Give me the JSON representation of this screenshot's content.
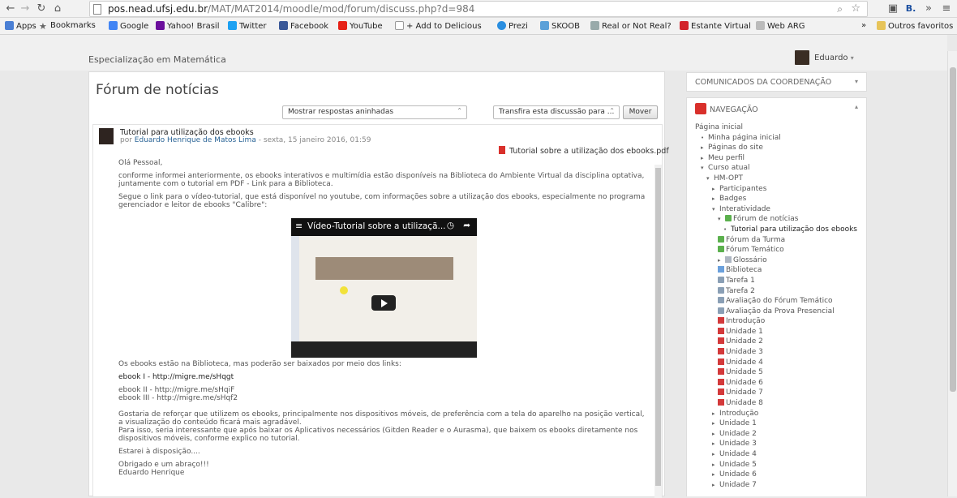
{
  "browser": {
    "url_host": "pos.nead.ufsj.edu.br",
    "url_path": "/MAT/MAT2014/moodle/mod/forum/discuss.php?d=984",
    "bookmarks": [
      "Apps",
      "Bookmarks",
      "Google",
      "Yahoo! Brasil",
      "Twitter",
      "Facebook",
      "YouTube",
      "+ Add to Delicious",
      "Prezi",
      "SKOOB",
      "Real or Not Real?",
      "Estante Virtual",
      "Web ARG"
    ],
    "overflow": "»",
    "other_bookmarks": "Outros favoritos"
  },
  "header": {
    "site_name": "Especialização em Matemática",
    "user_name": "Eduardo"
  },
  "forum": {
    "title": "Fórum de notícias",
    "display_mode": "Mostrar respostas aninhadas",
    "move_select": "Transfira esta discussão para ...",
    "move_button": "Mover"
  },
  "post": {
    "subject": "Tutorial para utilização dos ebooks",
    "by_prefix": "por",
    "author": "Eduardo Henrique de Matos Lima",
    "date": " - sexta, 15 janeiro 2016, 01:59",
    "attachment": "Tutorial sobre a utilização dos ebooks.pdf",
    "greeting": "Olá Pessoal,",
    "p1": "conforme informei anteriormente, os ebooks interativos e multimídia estão disponíveis na Biblioteca do Ambiente Virtual da disciplina optativa, juntamente com o tutorial em PDF - Link para a Biblioteca.",
    "p2": "Segue o link para o vídeo-tutorial, que está disponível no youtube, com informações sobre a utilização dos ebooks, especialmente no programa gerenciador e leitor de ebooks \"Calibre\":",
    "video_title": "Vídeo-Tutorial sobre a utilizaçã...",
    "p3": "Os ebooks estão na Biblioteca, mas poderão ser baixados por meio dos links:",
    "link1": "ebook I - http://migre.me/sHqgt",
    "link2": "ebook II - http://migre.me/sHqiF",
    "link3": "ebook III - http://migre.me/sHqf2",
    "p4": "Gostaria de reforçar que utilizem os ebooks, principalmente nos dispositivos móveis, de preferência com a tela do aparelho na posição vertical, a visualização do conteúdo ficará mais agradável.",
    "p5": "Para isso, seria interessante que após baixar os Aplicativos necessários (Gitden Reader e o Aurasma), que baixem os ebooks diretamente nos dispositivos móveis, conforme explico no tutorial.",
    "p6": "Estarei à disposição....",
    "p7": "Obrigado e um abraço!!!",
    "signature": "Eduardo Henrique"
  },
  "blocks": {
    "comunicados": "COMUNICADOS DA COORDENAÇÃO",
    "navegacao": "NAVEGAÇÃO"
  },
  "nav": [
    {
      "label": "Página inicial",
      "indent": 0,
      "marker": "",
      "icon": ""
    },
    {
      "label": "Minha página inicial",
      "indent": 1,
      "marker": "•",
      "icon": ""
    },
    {
      "label": "Páginas do site",
      "indent": 1,
      "marker": "▸",
      "icon": ""
    },
    {
      "label": "Meu perfil",
      "indent": 1,
      "marker": "▸",
      "icon": ""
    },
    {
      "label": "Curso atual",
      "indent": 1,
      "marker": "▾",
      "icon": ""
    },
    {
      "label": "HM-OPT",
      "indent": 2,
      "marker": "▾",
      "icon": ""
    },
    {
      "label": "Participantes",
      "indent": 3,
      "marker": "▸",
      "icon": ""
    },
    {
      "label": "Badges",
      "indent": 3,
      "marker": "▸",
      "icon": ""
    },
    {
      "label": "Interatividade",
      "indent": 3,
      "marker": "▾",
      "icon": ""
    },
    {
      "label": "Fórum de notícias",
      "indent": 4,
      "marker": "▾",
      "icon": "g"
    },
    {
      "label": "Tutorial para utilização dos ebooks",
      "indent": 5,
      "marker": "•",
      "icon": "",
      "bold": true
    },
    {
      "label": "Fórum da Turma",
      "indent": 4,
      "marker": "",
      "icon": "g"
    },
    {
      "label": "Fórum Temático",
      "indent": 4,
      "marker": "",
      "icon": "g"
    },
    {
      "label": "Glossário",
      "indent": 4,
      "marker": "▸",
      "icon": "y"
    },
    {
      "label": "Biblioteca",
      "indent": 4,
      "marker": "",
      "icon": "b"
    },
    {
      "label": "Tarefa 1",
      "indent": 4,
      "marker": "",
      "icon": "a"
    },
    {
      "label": "Tarefa 2",
      "indent": 4,
      "marker": "",
      "icon": "a"
    },
    {
      "label": "Avaliação do Fórum Temático",
      "indent": 4,
      "marker": "",
      "icon": "a"
    },
    {
      "label": "Avaliação da Prova Presencial",
      "indent": 4,
      "marker": "",
      "icon": "a"
    },
    {
      "label": "Introdução",
      "indent": 4,
      "marker": "",
      "icon": "r"
    },
    {
      "label": "Unidade 1",
      "indent": 4,
      "marker": "",
      "icon": "r"
    },
    {
      "label": "Unidade 2",
      "indent": 4,
      "marker": "",
      "icon": "r"
    },
    {
      "label": "Unidade 3",
      "indent": 4,
      "marker": "",
      "icon": "r"
    },
    {
      "label": "Unidade 4",
      "indent": 4,
      "marker": "",
      "icon": "r"
    },
    {
      "label": "Unidade 5",
      "indent": 4,
      "marker": "",
      "icon": "r"
    },
    {
      "label": "Unidade 6",
      "indent": 4,
      "marker": "",
      "icon": "r"
    },
    {
      "label": "Unidade 7",
      "indent": 4,
      "marker": "",
      "icon": "r"
    },
    {
      "label": "Unidade 8",
      "indent": 4,
      "marker": "",
      "icon": "r"
    },
    {
      "label": "Introdução",
      "indent": 3,
      "marker": "▸",
      "icon": ""
    },
    {
      "label": "Unidade 1",
      "indent": 3,
      "marker": "▸",
      "icon": ""
    },
    {
      "label": "Unidade 2",
      "indent": 3,
      "marker": "▸",
      "icon": ""
    },
    {
      "label": "Unidade 3",
      "indent": 3,
      "marker": "▸",
      "icon": ""
    },
    {
      "label": "Unidade 4",
      "indent": 3,
      "marker": "▸",
      "icon": ""
    },
    {
      "label": "Unidade 5",
      "indent": 3,
      "marker": "▸",
      "icon": ""
    },
    {
      "label": "Unidade 6",
      "indent": 3,
      "marker": "▸",
      "icon": ""
    },
    {
      "label": "Unidade 7",
      "indent": 3,
      "marker": "▸",
      "icon": ""
    }
  ],
  "colors": {
    "accent": "#2a6496",
    "nav_icon_red": "#d3393a",
    "nav_header_icon": "#d9302b"
  }
}
